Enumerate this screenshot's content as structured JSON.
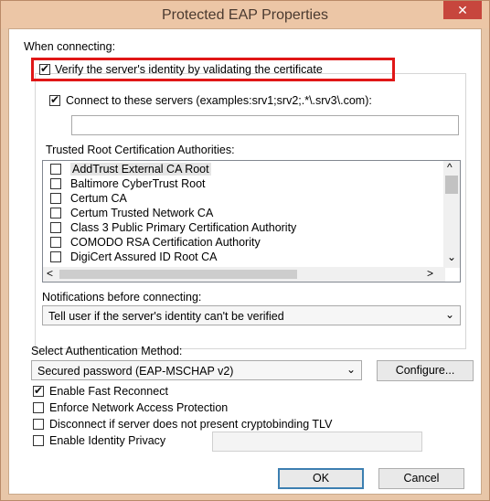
{
  "window": {
    "title": "Protected EAP Properties",
    "close_glyph": "✕"
  },
  "when_connecting": {
    "label": "When connecting:",
    "verify_label": "Verify the server's identity by validating the certificate",
    "verify_checked": true,
    "connect_label": "Connect to these servers (examples:srv1;srv2;.*\\.srv3\\.com):",
    "connect_checked": true,
    "servers_value": ""
  },
  "trusted_root": {
    "label": "Trusted Root Certification Authorities:",
    "items": [
      {
        "label": "AddTrust External CA Root",
        "checked": false
      },
      {
        "label": "Baltimore CyberTrust Root",
        "checked": false
      },
      {
        "label": "Certum CA",
        "checked": false
      },
      {
        "label": "Certum Trusted Network CA",
        "checked": false
      },
      {
        "label": "Class 3 Public Primary Certification Authority",
        "checked": false
      },
      {
        "label": "COMODO RSA Certification Authority",
        "checked": false
      },
      {
        "label": "DigiCert Assured ID Root CA",
        "checked": false
      }
    ]
  },
  "notifications": {
    "label": "Notifications before connecting:",
    "selected": "Tell user if the server's identity can't be verified"
  },
  "auth": {
    "label": "Select Authentication Method:",
    "selected": "Secured password (EAP-MSCHAP v2)",
    "configure_label": "Configure..."
  },
  "options": [
    {
      "label": "Enable Fast Reconnect",
      "checked": true
    },
    {
      "label": "Enforce Network Access Protection",
      "checked": false
    },
    {
      "label": "Disconnect if server does not present cryptobinding TLV",
      "checked": false
    },
    {
      "label": "Enable Identity Privacy",
      "checked": false
    }
  ],
  "identity_value": "",
  "buttons": {
    "ok_label": "OK",
    "cancel_label": "Cancel"
  },
  "scroll_glyphs": {
    "up": "^",
    "down": "⌄",
    "left": "<",
    "right": ">"
  },
  "colors": {
    "highlight_border": "#e01717",
    "default_button_border": "#3c7fb1"
  }
}
